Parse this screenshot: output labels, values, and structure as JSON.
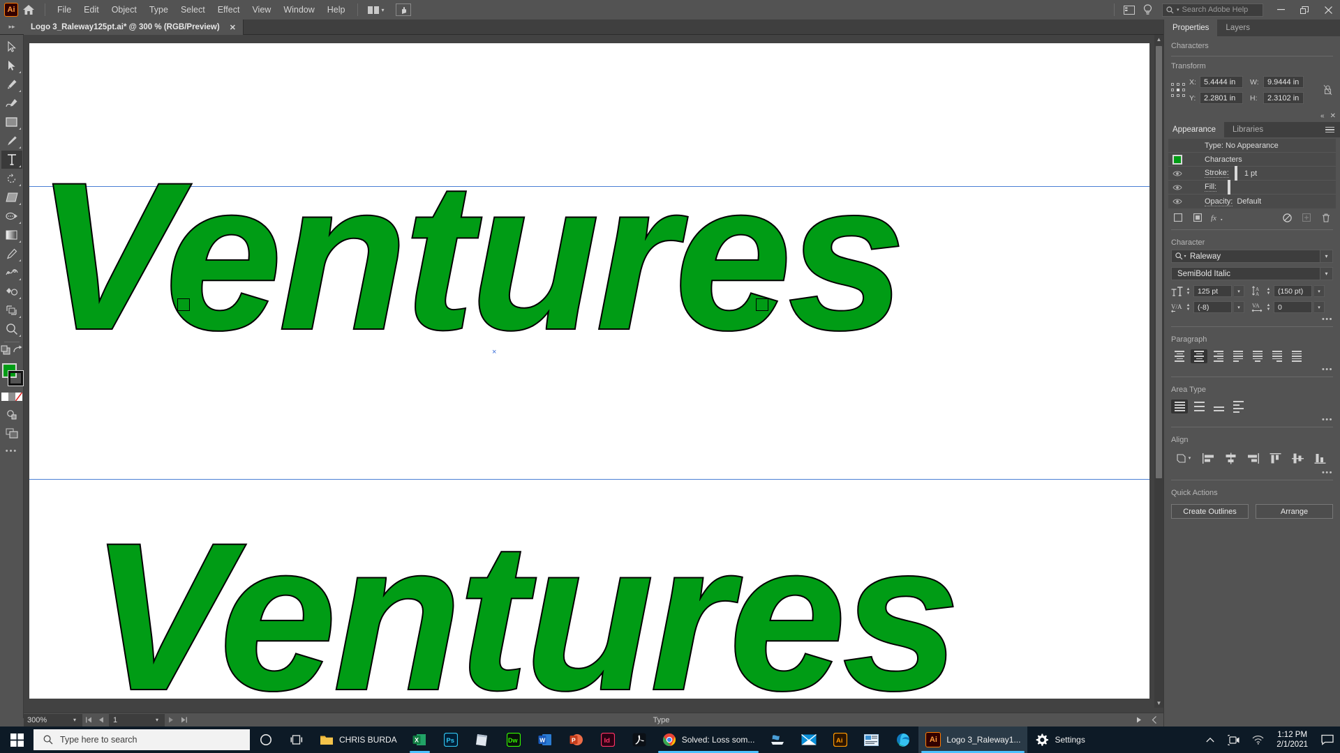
{
  "app": {
    "name": "Adobe Illustrator",
    "logo_text": "Ai"
  },
  "menubar": {
    "items": [
      "File",
      "Edit",
      "Object",
      "Type",
      "Select",
      "Effect",
      "View",
      "Window",
      "Help"
    ],
    "search_placeholder": "Search Adobe Help",
    "window_controls": [
      "—",
      "❐",
      "✕"
    ]
  },
  "document_tab": {
    "title": "Logo 3_Raleway125pt.ai* @ 300 % (RGB/Preview)",
    "close_label": "✕"
  },
  "toolbar": {
    "tools": [
      {
        "name": "selection-tool",
        "label": "Selection"
      },
      {
        "name": "direct-selection-tool",
        "label": "Direct Selection"
      },
      {
        "name": "pen-tool",
        "label": "Pen"
      },
      {
        "name": "curvature-tool",
        "label": "Curvature"
      },
      {
        "name": "rectangle-tool",
        "label": "Rectangle"
      },
      {
        "name": "paintbrush-tool",
        "label": "Paintbrush"
      },
      {
        "name": "type-tool",
        "label": "Type"
      },
      {
        "name": "rotate-tool",
        "label": "Rotate"
      },
      {
        "name": "shaper-tool",
        "label": "Shaper"
      },
      {
        "name": "width-tool",
        "label": "Width"
      },
      {
        "name": "gradient-tool",
        "label": "Gradient"
      },
      {
        "name": "eyedropper-tool",
        "label": "Eyedropper"
      },
      {
        "name": "blend-tool",
        "label": "Blend"
      },
      {
        "name": "symbol-sprayer-tool",
        "label": "Symbol Sprayer"
      },
      {
        "name": "artboard-tool",
        "label": "Artboard"
      },
      {
        "name": "zoom-tool",
        "label": "Zoom"
      }
    ],
    "active_tool": "type-tool",
    "fill_color": "#009c15",
    "stroke_color": "#111111",
    "more_label": "•••"
  },
  "canvas": {
    "artwork_text": "Ventures",
    "artwork_text_2": "Ventures",
    "fill_color": "#009c15",
    "stroke_color": "#000000",
    "guide_color": "#4a7fd4",
    "background": "#424242"
  },
  "statusbar": {
    "zoom_level": "300%",
    "page_number": "1",
    "tool_label": "Type",
    "nav_first": "⏮",
    "nav_prev": "◀",
    "nav_next": "▶",
    "nav_last": "⏭"
  },
  "properties_panel": {
    "tabs": [
      {
        "label": "Properties",
        "active": true
      },
      {
        "label": "Layers",
        "active": false
      }
    ],
    "selection_label": "Characters",
    "transform": {
      "title": "Transform",
      "x_label": "X:",
      "x_value": "5.4444 in",
      "y_label": "Y:",
      "y_value": "2.2801 in",
      "w_label": "W:",
      "w_value": "9.9444 in",
      "h_label": "H:",
      "h_value": "2.3102 in"
    },
    "appearance": {
      "tabs": [
        {
          "label": "Appearance",
          "active": true
        },
        {
          "label": "Libraries",
          "active": false
        }
      ],
      "type_row": "Type: No Appearance",
      "characters_row": "Characters",
      "stroke_label": "Stroke:",
      "stroke_value": "1 pt",
      "fill_label": "Fill:",
      "opacity_label": "Opacity:",
      "opacity_value": "Default",
      "fill_color": "#009c15",
      "stroke_color": "#111111"
    },
    "character": {
      "title": "Character",
      "font_family": "Raleway",
      "font_style": "SemiBold Italic",
      "font_size": "125 pt",
      "leading": "(150 pt)",
      "kerning": "(-8)",
      "tracking": "0",
      "more_label": "•••"
    },
    "paragraph": {
      "title": "Paragraph",
      "align_options": [
        "align-left",
        "align-center",
        "align-right",
        "justify-last-left",
        "justify-last-center",
        "justify-last-right",
        "justify-all"
      ],
      "selected_index": 1,
      "more_label": "•••"
    },
    "area_type": {
      "title": "Area Type",
      "options": [
        "area-type-fill",
        "area-type-2",
        "area-type-3",
        "area-type-4"
      ],
      "selected_index": 0,
      "more_label": "•••"
    },
    "align": {
      "title": "Align",
      "target_label": "align-to-selection",
      "options": [
        "align-left-edges",
        "align-horizontal-center",
        "align-right-edges",
        "align-top-edges",
        "align-vertical-center",
        "align-bottom-edges"
      ],
      "more_label": "•••"
    },
    "quick_actions": {
      "title": "Quick Actions",
      "buttons": [
        "Create Outlines",
        "Arrange"
      ]
    }
  },
  "taskbar": {
    "search_placeholder": "Type here to search",
    "items": [
      {
        "name": "cortana",
        "label": ""
      },
      {
        "name": "task-view",
        "label": ""
      },
      {
        "name": "file-explorer-chris-burda",
        "label": "CHRIS BURDA"
      },
      {
        "name": "excel",
        "label": ""
      },
      {
        "name": "photoshop",
        "label": ""
      },
      {
        "name": "sticky-notes",
        "label": ""
      },
      {
        "name": "dreamweaver",
        "label": ""
      },
      {
        "name": "word",
        "label": ""
      },
      {
        "name": "powerpoint",
        "label": ""
      },
      {
        "name": "indesign",
        "label": ""
      },
      {
        "name": "acrobat",
        "label": ""
      },
      {
        "name": "chrome",
        "label": "Solved: Loss som..."
      },
      {
        "name": "scanner",
        "label": ""
      },
      {
        "name": "mail",
        "label": ""
      },
      {
        "name": "illustrator",
        "label": ""
      },
      {
        "name": "remote-desktop",
        "label": ""
      },
      {
        "name": "edge",
        "label": ""
      },
      {
        "name": "illustrator-doc",
        "label": "Logo 3_Raleway1..."
      },
      {
        "name": "settings",
        "label": "Settings"
      }
    ],
    "tray": {
      "time": "1:12 PM",
      "date": "2/1/2021"
    }
  }
}
